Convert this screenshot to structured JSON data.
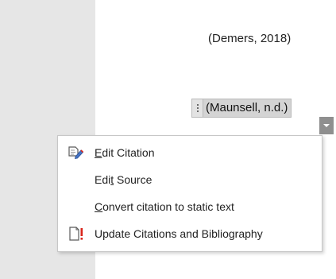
{
  "document": {
    "static_citation": "(Demers, 2018)",
    "citation_control": {
      "text": "(Maunsell, n.d.)"
    }
  },
  "context_menu": {
    "items": [
      {
        "id": "edit-citation",
        "before": "",
        "accel": "E",
        "after": "dit Citation",
        "icon": "edit-citation-icon"
      },
      {
        "id": "edit-source",
        "before": "Edi",
        "accel": "t",
        "after": " Source",
        "icon": ""
      },
      {
        "id": "convert-citation",
        "before": "",
        "accel": "C",
        "after": "onvert citation to static text",
        "icon": ""
      },
      {
        "id": "update-citations",
        "before": "",
        "accel": "",
        "after": "Update Citations and Bibliography",
        "icon": "update-document-icon"
      }
    ]
  },
  "colors": {
    "icon_blue": "#4472c4",
    "icon_red": "#d9261c"
  }
}
